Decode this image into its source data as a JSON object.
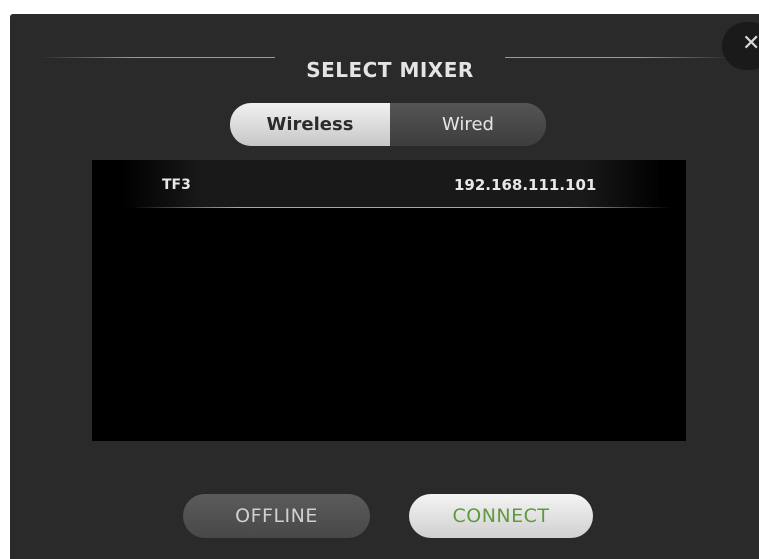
{
  "dialog": {
    "title": "SELECT MIXER",
    "close_icon_glyph": "✕"
  },
  "connection_tabs": [
    {
      "label": "Wireless",
      "selected": true
    },
    {
      "label": "Wired",
      "selected": false
    }
  ],
  "mixers": [
    {
      "name": "TF3",
      "ip": "192.168.111.101"
    }
  ],
  "actions": {
    "offline_label": "OFFLINE",
    "connect_label": "CONNECT"
  },
  "colors": {
    "dialog_bg": "#2a2a2a",
    "list_bg": "#000000",
    "connect_text": "#5f9b3e"
  }
}
